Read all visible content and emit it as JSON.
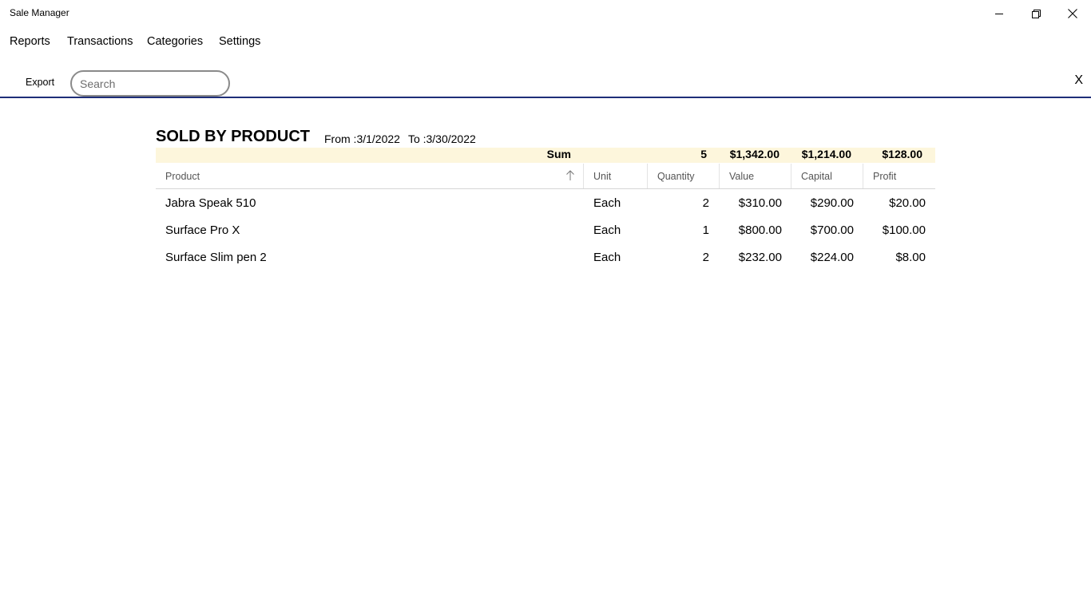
{
  "window": {
    "title": "Sale Manager",
    "controls": [
      "minimize-icon",
      "restore-icon",
      "close-icon"
    ]
  },
  "menu": {
    "items": [
      {
        "label": "Reports"
      },
      {
        "label": "Transactions"
      },
      {
        "label": "Categories"
      },
      {
        "label": "Settings"
      }
    ]
  },
  "toolbar": {
    "export_label": "Export",
    "search_placeholder": "Search",
    "search_value": "",
    "close_label": "X"
  },
  "colors": {
    "accent": "#1e2e78",
    "sum_background": "#fdf6dc"
  },
  "report": {
    "title": "SOLD BY PRODUCT",
    "from": "From :3/1/2022",
    "to": "To :3/30/2022",
    "sum": {
      "label": "Sum",
      "quantity": "5",
      "value": "$1,342.00",
      "capital": "$1,214.00",
      "profit": "$128.00"
    },
    "columns": [
      "Product",
      "Unit",
      "Quantity",
      "Value",
      "Capital",
      "Profit"
    ],
    "sort_icon": "arrow-up-icon",
    "rows": [
      {
        "product": "Jabra Speak 510",
        "unit": "Each",
        "quantity": "2",
        "value": "$310.00",
        "capital": "$290.00",
        "profit": "$20.00"
      },
      {
        "product": "Surface Pro X",
        "unit": "Each",
        "quantity": "1",
        "value": "$800.00",
        "capital": "$700.00",
        "profit": "$100.00"
      },
      {
        "product": "Surface Slim pen 2",
        "unit": "Each",
        "quantity": "2",
        "value": "$232.00",
        "capital": "$224.00",
        "profit": "$8.00"
      }
    ]
  }
}
